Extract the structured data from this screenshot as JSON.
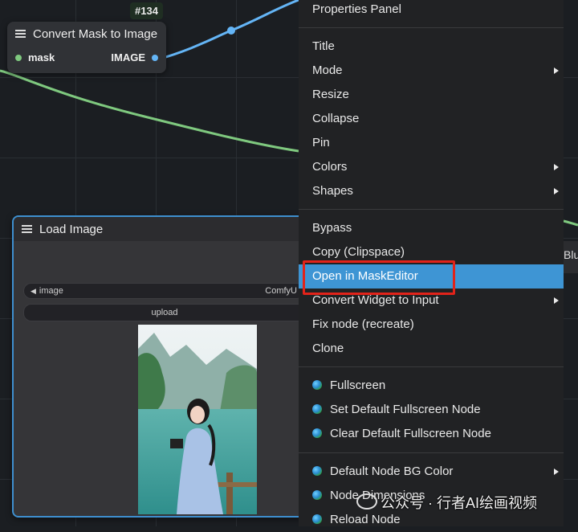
{
  "node134": {
    "badge": "#134",
    "title": "Convert Mask to Image",
    "input_label": "mask",
    "output_label": "IMAGE"
  },
  "load_image": {
    "title": "Load Image",
    "combo_label": "image",
    "combo_value": "ComfyU",
    "upload_label": "upload"
  },
  "context_menu": {
    "items": [
      {
        "label": "Properties Panel",
        "submenu": false
      },
      {
        "label": "Title",
        "submenu": false
      },
      {
        "label": "Mode",
        "submenu": true
      },
      {
        "label": "Resize",
        "submenu": false
      },
      {
        "label": "Collapse",
        "submenu": false
      },
      {
        "label": "Pin",
        "submenu": false
      },
      {
        "label": "Colors",
        "submenu": true
      },
      {
        "label": "Shapes",
        "submenu": true
      },
      {
        "label": "Bypass",
        "submenu": false
      },
      {
        "label": "Copy (Clipspace)",
        "submenu": false
      },
      {
        "label": "Open in MaskEditor",
        "submenu": false,
        "highlighted": true
      },
      {
        "label": "Convert Widget to Input",
        "submenu": true
      },
      {
        "label": "Fix node (recreate)",
        "submenu": false
      },
      {
        "label": "Clone",
        "submenu": false
      },
      {
        "label": "Fullscreen",
        "icon": "globe-icon"
      },
      {
        "label": "Set Default Fullscreen Node",
        "icon": "globe-icon"
      },
      {
        "label": "Clear Default Fullscreen Node",
        "icon": "globe-icon"
      },
      {
        "label": "Default Node BG Color",
        "icon": "globe-icon",
        "submenu": true
      },
      {
        "label": "Node Dimensions",
        "icon": "globe-icon"
      },
      {
        "label": "Reload Node",
        "icon": "globe-icon"
      }
    ]
  },
  "edge_text": "Blu",
  "watermark": "公众号 · 行者AI绘画视频",
  "colors": {
    "accent": "#3e95d4",
    "highlight_box": "#e2231a",
    "mask_link": "#7fc97f",
    "image_link": "#64b5f6"
  }
}
